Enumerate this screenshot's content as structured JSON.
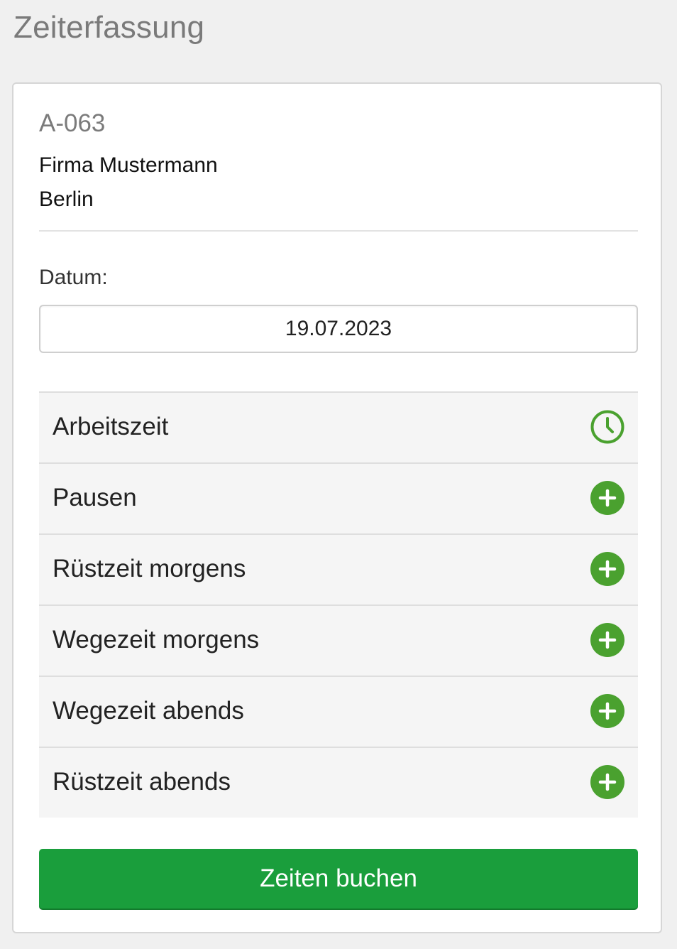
{
  "page": {
    "title": "Zeiterfassung"
  },
  "order": {
    "number": "A-063",
    "company": "Firma Mustermann",
    "city": "Berlin"
  },
  "date": {
    "label": "Datum:",
    "value": "19.07.2023"
  },
  "time_entries": [
    {
      "label": "Arbeitszeit",
      "icon": "clock-icon"
    },
    {
      "label": "Pausen",
      "icon": "plus-circle-icon"
    },
    {
      "label": "Rüstzeit morgens",
      "icon": "plus-circle-icon"
    },
    {
      "label": "Wegezeit morgens",
      "icon": "plus-circle-icon"
    },
    {
      "label": "Wegezeit abends",
      "icon": "plus-circle-icon"
    },
    {
      "label": "Rüstzeit abends",
      "icon": "plus-circle-icon"
    }
  ],
  "actions": {
    "book_label": "Zeiten buchen"
  },
  "colors": {
    "accent_green": "#4aa12f",
    "button_green": "#1a9e3c",
    "page_background": "#f0f0f0"
  }
}
